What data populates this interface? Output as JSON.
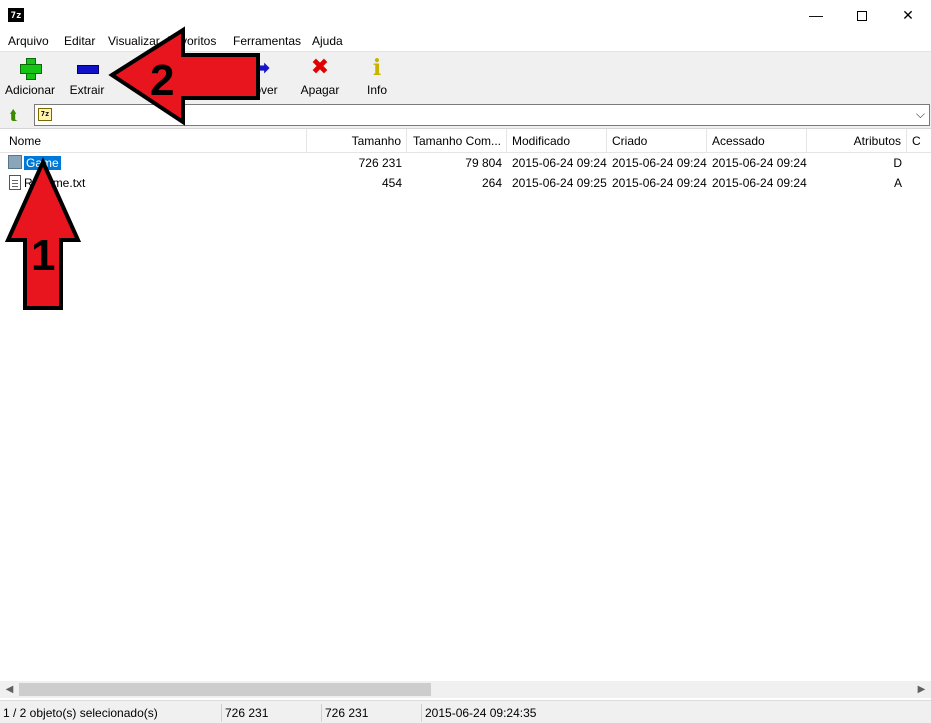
{
  "window": {
    "app_icon_text": "7z",
    "minimize_glyph": "—",
    "close_glyph": "✕"
  },
  "menu": [
    "Arquivo",
    "Editar",
    "Visualizar",
    "Favoritos",
    "Ferramentas",
    "Ajuda"
  ],
  "toolbar": {
    "add_label": "Adicionar",
    "extract_label": "Extrair",
    "move_label": "Mover",
    "delete_label": "Apagar",
    "info_label": "Info"
  },
  "address": {
    "path": "",
    "dropdown_glyph": "⌵"
  },
  "columns": [
    "Nome",
    "Tamanho",
    "Tamanho Com...",
    "Modificado",
    "Criado",
    "Acessado",
    "Atributos",
    "C"
  ],
  "rows": [
    {
      "name": "Game",
      "type": "folder",
      "size": "726 231",
      "packed": "79 804",
      "modified": "2015-06-24 09:24",
      "created": "2015-06-24 09:24",
      "accessed": "2015-06-24 09:24",
      "attributes": "D",
      "selected": true
    },
    {
      "name": "Readme.txt",
      "type": "file",
      "size": "454",
      "packed": "264",
      "modified": "2015-06-24 09:25",
      "created": "2015-06-24 09:24",
      "accessed": "2015-06-24 09:24",
      "attributes": "A",
      "selected": false
    }
  ],
  "status": {
    "selection": "1 / 2 objeto(s) selecionado(s)",
    "size": "726 231",
    "total": "726 231",
    "date": "2015-06-24 09:24:35"
  },
  "annotations": {
    "arrow1_label": "1",
    "arrow2_label": "2",
    "color": "#e8141e"
  },
  "colors": {
    "selection": "#0078d7",
    "toolbar_bg": "#f0f0f0"
  }
}
